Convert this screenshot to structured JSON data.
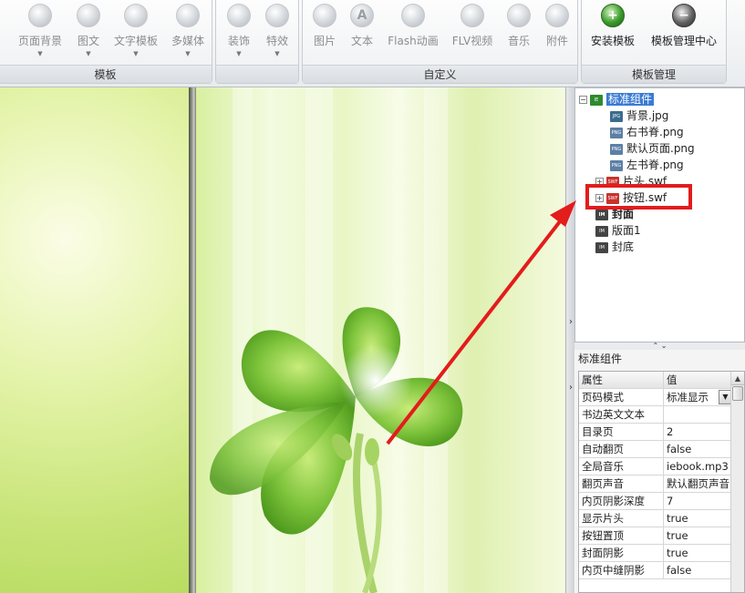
{
  "ribbon": {
    "groups": [
      {
        "label": "模板",
        "buttons": [
          "页面背景",
          "图文",
          "文字模板",
          "多媒体"
        ]
      },
      {
        "label": "",
        "buttons": [
          "装饰",
          "特效"
        ]
      },
      {
        "label": "自定义",
        "buttons": [
          "图片",
          "文本",
          "Flash动画",
          "FLV视频",
          "音乐",
          "附件"
        ]
      },
      {
        "label": "模板管理",
        "buttons": [
          "安装模板",
          "模板管理中心"
        ]
      }
    ],
    "icons": {
      "page_bg": "page-background-icon",
      "graphic_text": "graphic-text-icon",
      "text_template": "text-template-icon",
      "multimedia": "multimedia-icon",
      "decoration": "decoration-icon",
      "effects": "effects-icon",
      "image": "image-icon",
      "text": "text-icon",
      "flash": "flash-icon",
      "flv": "flv-video-icon",
      "music": "music-icon",
      "attachment": "attachment-icon",
      "install": "install-template-icon",
      "manage": "template-manager-icon"
    }
  },
  "tree": {
    "root": "标准组件",
    "children": [
      "背景.jpg",
      "右书脊.png",
      "默认页面.png",
      "左书脊.png",
      "片头.swf",
      "按钮.swf"
    ],
    "badges": {
      "ie": "IE",
      "jpg": "JPG",
      "png": "PNG",
      "swf": "SWF",
      "im": "IM"
    },
    "pages": [
      "封面",
      "版面1",
      "封底"
    ]
  },
  "properties": {
    "title": "标准组件",
    "headers": [
      "属性",
      "值"
    ],
    "rows": [
      [
        "页码模式",
        "标准显示"
      ],
      [
        "书边英文文本",
        ""
      ],
      [
        "目录页",
        "2"
      ],
      [
        "自动翻页",
        "false"
      ],
      [
        "全局音乐",
        "iebook.mp3"
      ],
      [
        "翻页声音",
        "默认翻页声音"
      ],
      [
        "内页阴影深度",
        "7"
      ],
      [
        "显示片头",
        "true"
      ],
      [
        "按钮置顶",
        "true"
      ],
      [
        "封面阴影",
        "true"
      ],
      [
        "内页中缝阴影",
        "false"
      ]
    ]
  },
  "colors": {
    "highlight": "#e31c1c",
    "selection": "#3b7bd4"
  }
}
